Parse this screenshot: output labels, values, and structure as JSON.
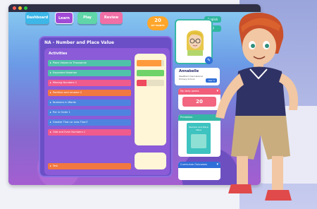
{
  "nav": {
    "dashboard": "Dashboard",
    "learn": "Learn",
    "play": "Play",
    "review": "Review"
  },
  "score": {
    "value": "20",
    "label": "MY POINTS"
  },
  "header_buttons": {
    "language": "English",
    "search_icon": "search-icon"
  },
  "panel": {
    "title": "NA - Number and Place Value",
    "activities_heading": "Activities",
    "activities": [
      {
        "label": "Place Values to Thousands",
        "color": "#4fc3a9",
        "progress": 0.9,
        "bar": "#ff9a3c"
      },
      {
        "label": "Expanded Notation",
        "color": "#4fc3a9",
        "progress": 1.0,
        "bar": "#6fd36a"
      },
      {
        "label": "Missing Numbers 1",
        "color": "#ef5b8c",
        "progress": 0.35,
        "bar": "#ef4a5e"
      },
      {
        "label": "Partition and rename 2",
        "color": "#f17840",
        "progress": 0,
        "bar": "#e8e0c4"
      },
      {
        "label": "Numbers in Words",
        "color": "#4f83e0",
        "progress": 0,
        "bar": "#e8e0c4"
      },
      {
        "label": "Put in Order 1",
        "color": "#4f83e0",
        "progress": 0,
        "bar": "#e8e0c4"
      },
      {
        "label": "Greater Than or Less Than?",
        "color": "#4f83e0",
        "progress": 0,
        "bar": "#e8e0c4"
      },
      {
        "label": "Odd and Even Numbers 1",
        "color": "#ef5b8c",
        "progress": 0,
        "bar": "#e8e0c4"
      }
    ],
    "test": {
      "label": "Test",
      "color": "#f17840"
    }
  },
  "profile": {
    "name": "Annabelle",
    "school": "Westfield International Primary School",
    "year": "Year 4"
  },
  "daily_points": {
    "heading": "My daily points",
    "value": "20"
  },
  "printables": {
    "heading": "Printables",
    "book_title": "Number and Place Value"
  },
  "outcomes": {
    "heading": "Curriculum Outcomes"
  },
  "colors": {
    "accent": "#35b7a6",
    "panel": "#6b4fc7",
    "score": "#ffa62b"
  }
}
